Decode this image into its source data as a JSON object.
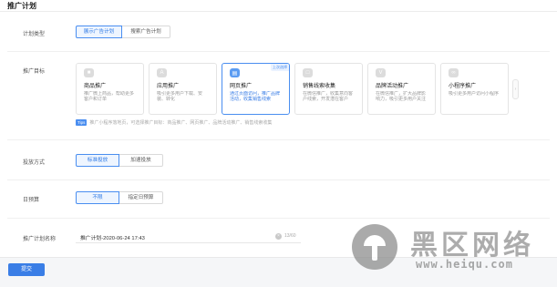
{
  "page": {
    "title": "推广计划"
  },
  "plan_type": {
    "label": "计划类型",
    "options": [
      "展示广告计划",
      "搜索广告计划"
    ],
    "selected": "展示广告计划"
  },
  "goal": {
    "label": "推广目标",
    "cards": [
      {
        "icon": "shopping-bag-icon",
        "title": "商品推广",
        "desc": "推广微上商品，帮助更多客户和订单",
        "badge": ""
      },
      {
        "icon": "app-store-icon",
        "title": "应用推广",
        "desc": "吸引更多用户下载、安装、转化",
        "badge": ""
      },
      {
        "icon": "web-page-icon",
        "title": "网页推广",
        "desc": "通过页面访问，推广品牌活动，收集销售线索",
        "badge": "上次选择"
      },
      {
        "icon": "message-icon",
        "title": "销售线索收集",
        "desc": "在微信推广，收集意向客户线索，开发潜在客户",
        "badge": ""
      },
      {
        "icon": "brand-icon",
        "title": "品牌活动推广",
        "desc": "在微信推广，扩大品牌影响力，吸引更多用户关注",
        "badge": ""
      },
      {
        "icon": "mini-program-icon",
        "title": "小程序推广",
        "desc": "吸引更多用户访问小程序",
        "badge": ""
      }
    ],
    "tips_tag": "Tips",
    "tips_text": "推广小程序落地页，可选择推广目标：商品推广、网页推广、品牌活动推广、销售线索收集"
  },
  "delivery": {
    "label": "投放方式",
    "options": [
      "标准投放",
      "加速投放"
    ],
    "selected": "标准投放"
  },
  "budget": {
    "label": "日预算",
    "options": [
      "不限",
      "指定日预算"
    ],
    "selected": "不限"
  },
  "plan_name": {
    "label": "推广计划名称",
    "value": "推广计划-2020-06-24 17:43",
    "count": "13/60",
    "clear_icon": "clear-icon"
  },
  "footer": {
    "submit_label": "提交"
  },
  "watermark": {
    "cn": "黑区网络",
    "url": "www.heiqu.com"
  },
  "colors": {
    "accent": "#3a7ee6",
    "selected_bg": "#eef5ff"
  }
}
